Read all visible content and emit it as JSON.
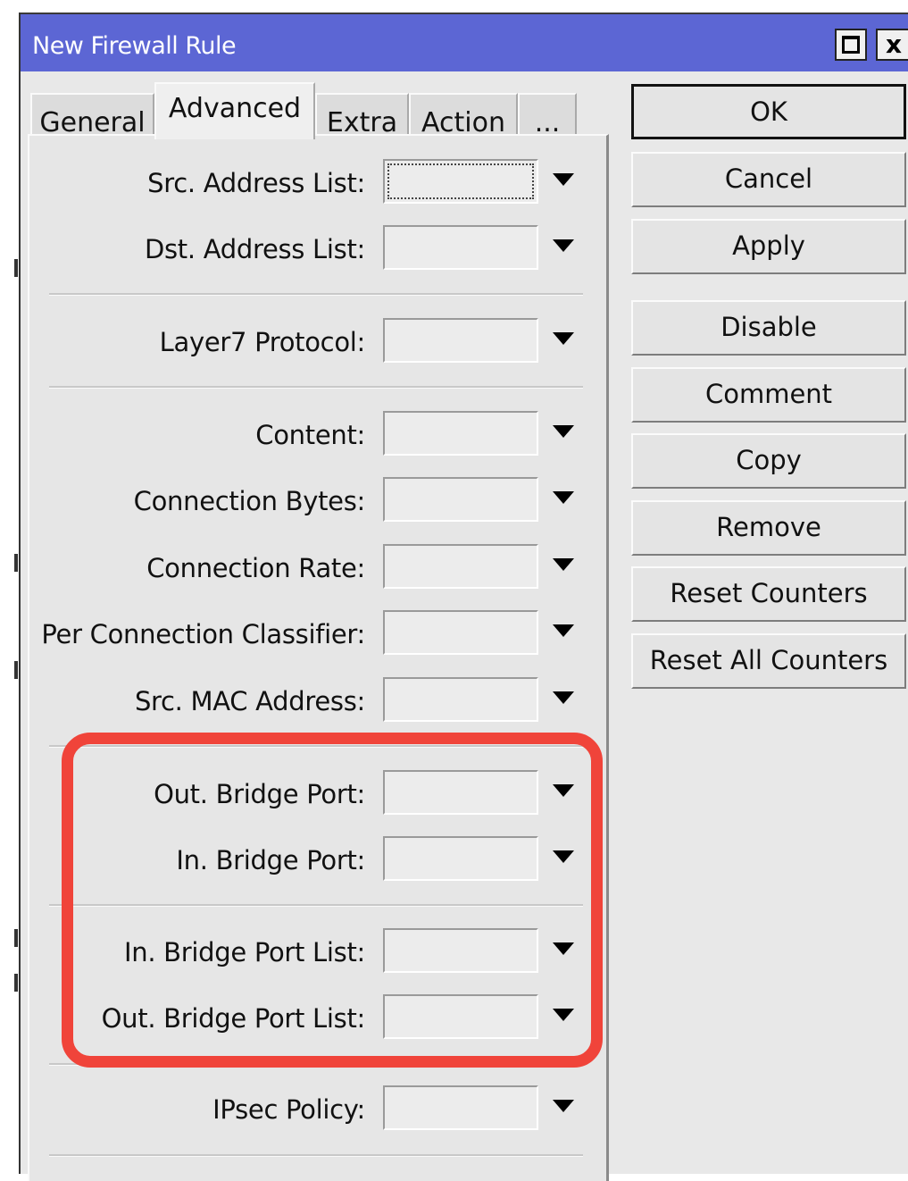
{
  "window": {
    "title": "New Firewall Rule",
    "maximize_label": "",
    "close_label": "x"
  },
  "tabs": [
    {
      "label": "General",
      "active": false
    },
    {
      "label": "Advanced",
      "active": true
    },
    {
      "label": "Extra",
      "active": false
    },
    {
      "label": "Action",
      "active": false
    },
    {
      "label": "...",
      "active": false
    }
  ],
  "fields": {
    "src_address_list": {
      "label": "Src. Address List:",
      "value": ""
    },
    "dst_address_list": {
      "label": "Dst. Address List:",
      "value": ""
    },
    "layer7_protocol": {
      "label": "Layer7 Protocol:",
      "value": ""
    },
    "content": {
      "label": "Content:",
      "value": ""
    },
    "connection_bytes": {
      "label": "Connection Bytes:",
      "value": ""
    },
    "connection_rate": {
      "label": "Connection Rate:",
      "value": ""
    },
    "per_connection_classifier": {
      "label": "Per Connection Classifier:",
      "value": ""
    },
    "src_mac_address": {
      "label": "Src. MAC Address:",
      "value": ""
    },
    "out_bridge_port": {
      "label": "Out. Bridge Port:",
      "value": ""
    },
    "in_bridge_port": {
      "label": "In. Bridge Port:",
      "value": ""
    },
    "in_bridge_port_list": {
      "label": "In. Bridge Port List:",
      "value": ""
    },
    "out_bridge_port_list": {
      "label": "Out. Bridge Port List:",
      "value": ""
    },
    "ipsec_policy": {
      "label": "IPsec Policy:",
      "value": ""
    }
  },
  "buttons": {
    "ok": "OK",
    "cancel": "Cancel",
    "apply": "Apply",
    "disable": "Disable",
    "comment": "Comment",
    "copy": "Copy",
    "remove": "Remove",
    "reset_counters": "Reset Counters",
    "reset_all_counters": "Reset All Counters"
  },
  "colors": {
    "titlebar": "#5c66d4",
    "highlight": "#f0443a"
  }
}
